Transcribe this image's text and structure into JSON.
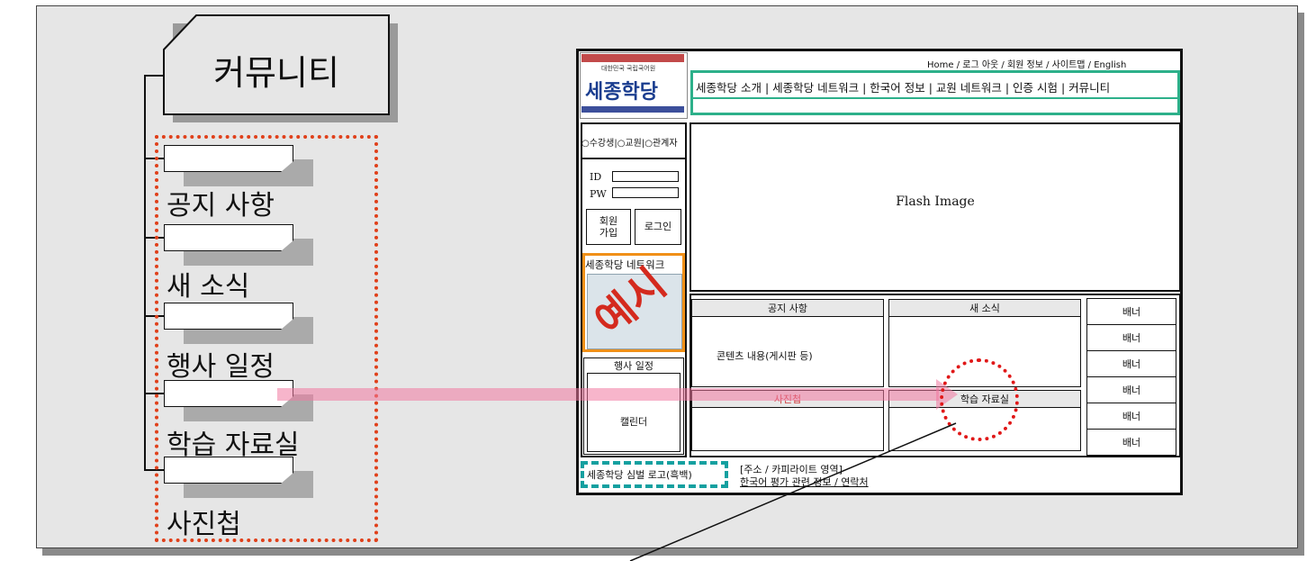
{
  "tree": {
    "root": "커뮤니티",
    "items": [
      "공지 사항",
      "새 소식",
      "행사 일정",
      "학습 자료실",
      "사진첩"
    ]
  },
  "mockup": {
    "top_nav": "Home / 로그 아웃 / 회원 정보 / 사이트맵 / English",
    "gnb": "세종학당 소개 | 세종학당 네트워크 | 한국어 정보 | 교원 네트워크 | 인증 시험 | 커뮤니티",
    "logo": {
      "small_text": "대한민국 국립국어원",
      "main_text": "세종학당"
    },
    "radio_row": "○수강생|○교원|○관계자",
    "login": {
      "id_label": "ID",
      "pw_label": "PW",
      "join_button": "회원\n가입",
      "login_button": "로그인"
    },
    "network_title": "세종학당 네트워크",
    "example_stamp": "예시",
    "event_title": "행사 일정",
    "calendar": "캘린더",
    "flash": "Flash Image",
    "panels": {
      "notice": "공지 사항",
      "news": "새 소식",
      "content_text": "콘텐츠 내용(게시판 등)",
      "photo": "사진첩",
      "study": "학습 자료실"
    },
    "banners": [
      "배너",
      "배너",
      "배너",
      "배너",
      "배너",
      "배너"
    ],
    "footer": {
      "symbol": "세종학당 심벌 로고(흑백)",
      "address_line1": "[주소 / 카피라이트 영역]",
      "address_line2": "한국어 평가 관련 정보 / 연락처"
    }
  },
  "colors": {
    "highlight_dotted": "#e0401a",
    "arrow": "#f078a0",
    "gnb_border": "#2db08a",
    "network_border": "#f09018",
    "footer_border": "#15a0a0",
    "circle": "#e01818"
  }
}
